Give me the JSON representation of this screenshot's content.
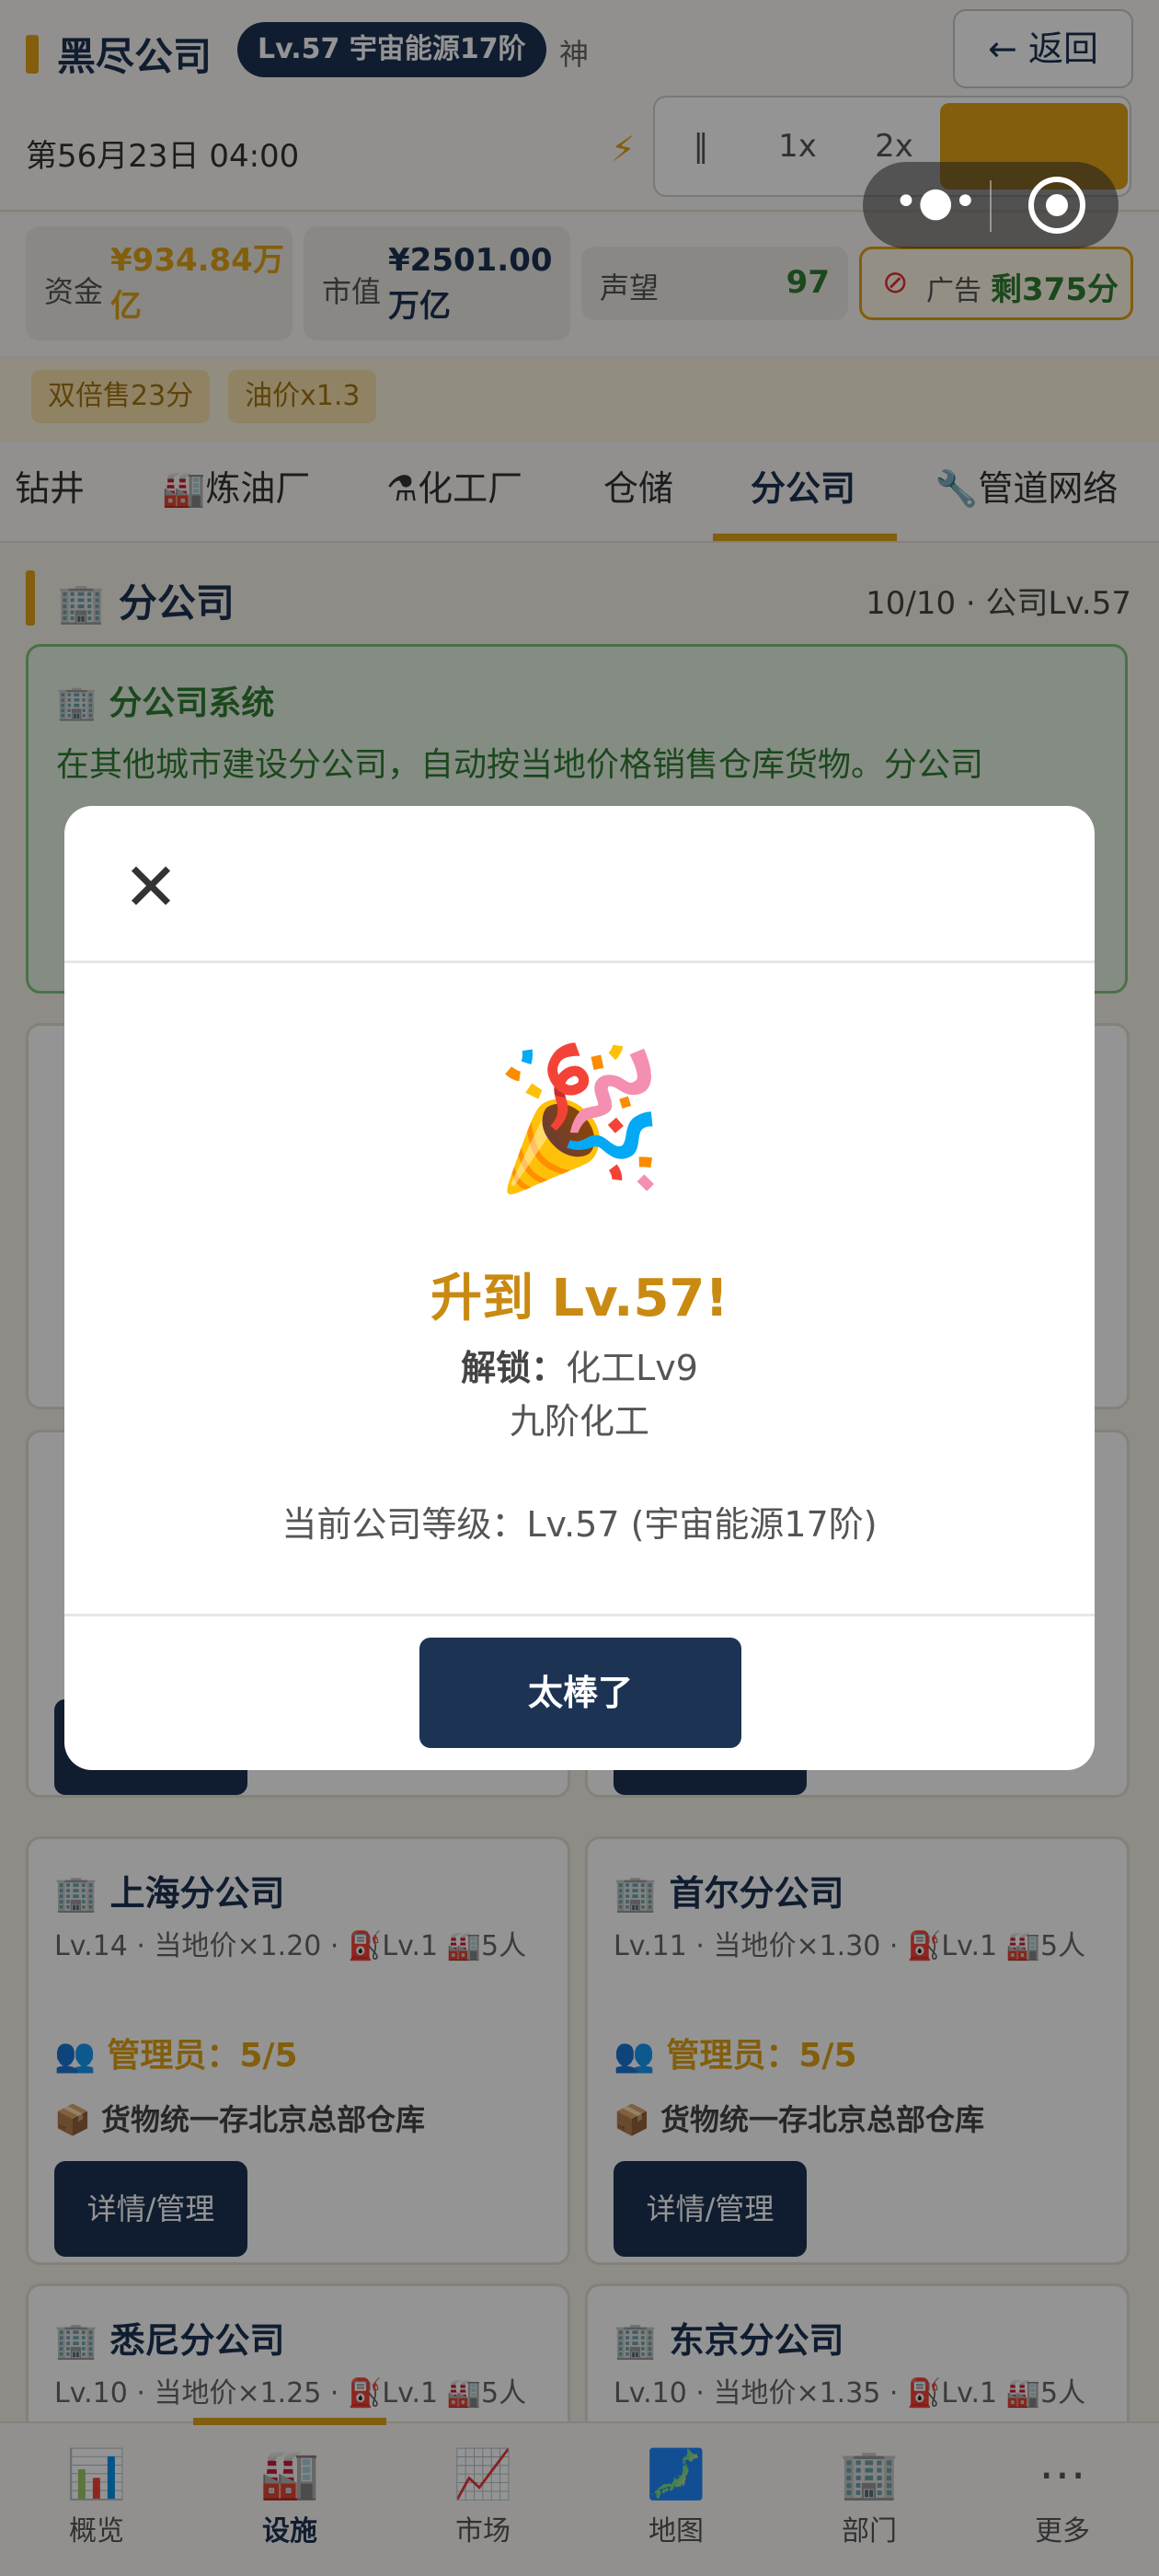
{
  "header": {
    "company": "黑尽公司",
    "level_badge": "Lv.57 宇宙能源17阶",
    "extra": "神",
    "back_label": "← 返回",
    "date": "第56月23日 04:00",
    "speed_pause": "‖",
    "speed_1x": "1x",
    "speed_2x": "2x"
  },
  "stats": {
    "funds_label": "资金",
    "funds_value_1": "¥934.84万",
    "funds_value_2": "亿",
    "market_label": "市值",
    "market_value_1": "¥2501.00",
    "market_value_2": "万亿",
    "rep_label": "声望",
    "rep_value": "97",
    "ad_label": "广告",
    "ad_remaining": "剩375分"
  },
  "buffs": [
    "双倍售23分",
    "油价x1.3"
  ],
  "tabs": [
    {
      "icon": "",
      "label": "钻井"
    },
    {
      "icon": "🏭",
      "label": "炼油厂"
    },
    {
      "icon": "⚗",
      "label": "化工厂"
    },
    {
      "icon": "",
      "label": "仓储"
    },
    {
      "icon": "",
      "label": "分公司"
    },
    {
      "icon": "🔧",
      "label": "管道网络"
    }
  ],
  "section": {
    "title": "分公司",
    "meta": "10/10 · 公司Lv.57",
    "info_title": "分公司系统",
    "info_text": "在其他城市建设分公司，自动按当地价格销售仓库货物。分公司"
  },
  "branches": [
    {
      "name": "上海分公司",
      "meta": "Lv.14 · 当地价×1.20 · ⛽Lv.1 🏭5人",
      "managers": "管理员：5/5",
      "cargo": "货物统一存北京总部仓库",
      "button": "详情/管理"
    },
    {
      "name": "首尔分公司",
      "meta": "Lv.11 · 当地价×1.30 · ⛽Lv.1 🏭5人",
      "managers": "管理员：5/5",
      "cargo": "货物统一存北京总部仓库",
      "button": "详情/管理"
    },
    {
      "name": "悉尼分公司",
      "meta": "Lv.10 · 当地价×1.25 · ⛽Lv.1 🏭5人",
      "managers": "",
      "cargo": "",
      "button": ""
    },
    {
      "name": "东京分公司",
      "meta": "Lv.10 · 当地价×1.35 · ⛽Lv.1 🏭5人",
      "managers": "",
      "cargo": "",
      "button": ""
    }
  ],
  "bottom_nav": [
    {
      "icon": "📊",
      "label": "概览"
    },
    {
      "icon": "🏭",
      "label": "设施"
    },
    {
      "icon": "📈",
      "label": "市场"
    },
    {
      "icon": "🗾",
      "label": "地图"
    },
    {
      "icon": "🏢",
      "label": "部门"
    },
    {
      "icon": "⋯",
      "label": "更多"
    }
  ],
  "modal": {
    "close": "✕",
    "emoji": "🎉",
    "title": "升到 Lv.57!",
    "unlock_label": "解锁：",
    "unlock_value": "化工Lv9",
    "unlock_name": "九阶化工",
    "current_level": "当前公司等级：Lv.57 (宇宙能源17阶)",
    "confirm": "太棒了"
  }
}
